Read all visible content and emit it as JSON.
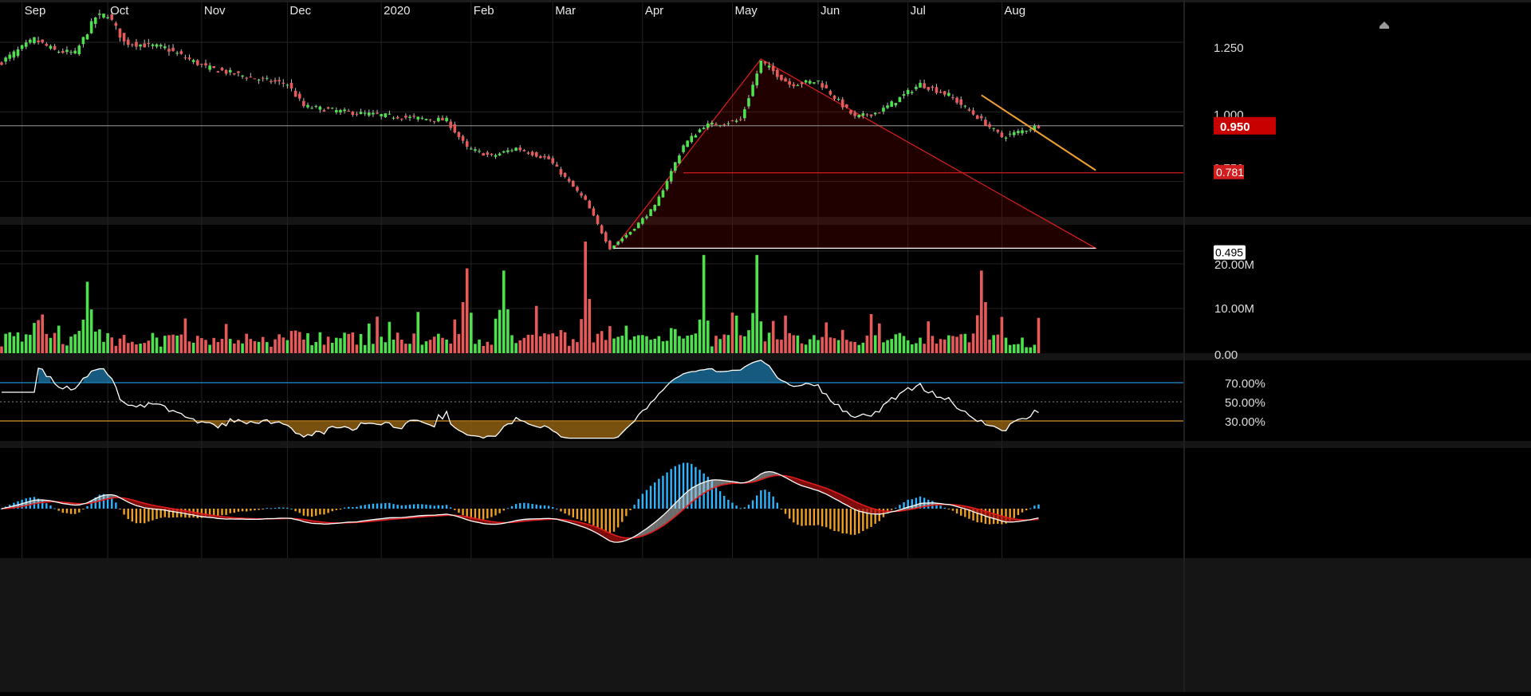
{
  "chart_data": [
    {
      "type": "candlestick",
      "pane": "price",
      "x_axis_labels": [
        "Sep",
        "Oct",
        "Nov",
        "Dec",
        "2020",
        "Feb",
        "Mar",
        "Apr",
        "May",
        "Jun",
        "Jul",
        "Aug"
      ],
      "y_ticks": [
        "1.250",
        "1.000",
        "0.750"
      ],
      "ylim": [
        0.4,
        1.37
      ],
      "last_price": "0.950",
      "level_labels": [
        "0.781",
        "0.495"
      ],
      "series_keypoints": [
        {
          "date": "2019-08-26",
          "close": 1.18
        },
        {
          "date": "2019-09-05",
          "close": 1.26
        },
        {
          "date": "2019-09-12",
          "close": 1.22
        },
        {
          "date": "2019-09-19",
          "close": 1.21
        },
        {
          "date": "2019-09-26",
          "close": 1.34
        },
        {
          "date": "2019-10-01",
          "close": 1.35
        },
        {
          "date": "2019-10-07",
          "close": 1.25
        },
        {
          "date": "2019-10-21",
          "close": 1.23
        },
        {
          "date": "2019-11-04",
          "close": 1.16
        },
        {
          "date": "2019-11-20",
          "close": 1.12
        },
        {
          "date": "2019-12-02",
          "close": 1.1
        },
        {
          "date": "2019-12-06",
          "close": 1.02
        },
        {
          "date": "2019-12-20",
          "close": 1.0
        },
        {
          "date": "2020-01-10",
          "close": 0.98
        },
        {
          "date": "2020-01-24",
          "close": 0.97
        },
        {
          "date": "2020-01-31",
          "close": 0.87
        },
        {
          "date": "2020-02-10",
          "close": 0.84
        },
        {
          "date": "2020-02-18",
          "close": 0.87
        },
        {
          "date": "2020-02-28",
          "close": 0.83
        },
        {
          "date": "2020-03-12",
          "close": 0.68
        },
        {
          "date": "2020-03-20",
          "close": 0.51
        },
        {
          "date": "2020-03-27",
          "close": 0.57
        },
        {
          "date": "2020-04-06",
          "close": 0.66
        },
        {
          "date": "2020-04-15",
          "close": 0.88
        },
        {
          "date": "2020-04-22",
          "close": 0.95
        },
        {
          "date": "2020-05-05",
          "close": 0.97
        },
        {
          "date": "2020-05-12",
          "close": 1.18
        },
        {
          "date": "2020-05-21",
          "close": 1.1
        },
        {
          "date": "2020-06-01",
          "close": 1.11
        },
        {
          "date": "2020-06-12",
          "close": 0.98
        },
        {
          "date": "2020-06-22",
          "close": 1.0
        },
        {
          "date": "2020-07-06",
          "close": 1.1
        },
        {
          "date": "2020-07-15",
          "close": 1.06
        },
        {
          "date": "2020-07-27",
          "close": 0.97
        },
        {
          "date": "2020-08-03",
          "close": 0.91
        },
        {
          "date": "2020-08-14",
          "close": 0.95
        }
      ],
      "overlays": {
        "horizontal_levels": [
          0.95,
          0.781,
          0.495
        ],
        "triangle": [
          [
            "2020-03-23",
            0.51
          ],
          [
            "2020-05-12",
            1.19
          ],
          [
            "2020-09-03",
            0.51
          ]
        ],
        "trendline": [
          [
            "2020-07-27",
            1.06
          ],
          [
            "2020-09-03",
            0.79
          ]
        ]
      },
      "colors": {
        "up": "#4de14d",
        "down": "#e85a5a",
        "triangle": "#d11d1d",
        "trend": "#f0a030",
        "last_price_bg": "#c80000"
      }
    },
    {
      "type": "bar",
      "pane": "volume",
      "y_ticks": [
        "20.00M",
        "10.00M",
        "0.00"
      ],
      "ylim": [
        0,
        28000000
      ],
      "spikes_millions": [
        {
          "date": "2019-09-24",
          "value": 16
        },
        {
          "date": "2020-01-31",
          "value": 19
        },
        {
          "date": "2020-02-13",
          "value": 18.5
        },
        {
          "date": "2020-03-12",
          "value": 25
        },
        {
          "date": "2020-04-22",
          "value": 22
        },
        {
          "date": "2020-05-11",
          "value": 22
        },
        {
          "date": "2020-07-27",
          "value": 18.5
        }
      ]
    },
    {
      "type": "line",
      "pane": "rsi",
      "y_ticks": [
        "70.00%",
        "50.00%",
        "30.00%"
      ],
      "ylim": [
        10,
        100
      ],
      "levels": [
        70,
        50,
        30
      ],
      "colors": {
        "line": "#ffffff",
        "overbought": "#1e8fd0",
        "oversold": "#e0942a"
      }
    },
    {
      "type": "line",
      "pane": "macd",
      "colors": {
        "macd": "#ffffff",
        "signal": "#e01b1b",
        "hist_pos": "#2db4ff",
        "hist_neg": "#f0a020"
      }
    }
  ]
}
